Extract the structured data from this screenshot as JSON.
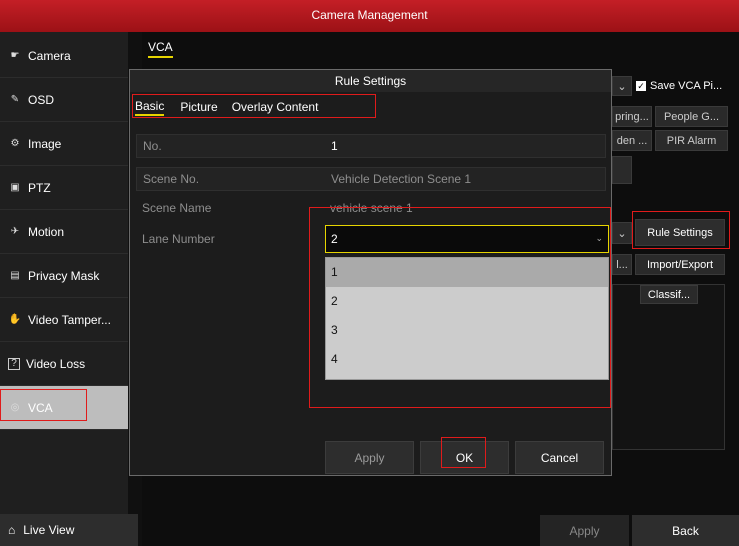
{
  "window": {
    "title": "Camera Management"
  },
  "sidebar": {
    "items": [
      {
        "label": "Camera",
        "icon": "camera-icon",
        "glyph": "☛"
      },
      {
        "label": "OSD",
        "icon": "osd-icon",
        "glyph": "✎"
      },
      {
        "label": "Image",
        "icon": "image-icon",
        "glyph": "⚙"
      },
      {
        "label": "PTZ",
        "icon": "ptz-icon",
        "glyph": "▣"
      },
      {
        "label": "Motion",
        "icon": "motion-icon",
        "glyph": "✈"
      },
      {
        "label": "Privacy Mask",
        "icon": "privacy-mask-icon",
        "glyph": "▤"
      },
      {
        "label": "Video Tamper...",
        "icon": "video-tamper-icon",
        "glyph": "✋"
      },
      {
        "label": "Video Loss",
        "icon": "video-loss-icon",
        "glyph": "?"
      },
      {
        "label": "VCA",
        "icon": "vca-icon",
        "glyph": "◎"
      }
    ],
    "active": "VCA",
    "live_view": "Live View"
  },
  "main": {
    "tab": "VCA",
    "save_vca": "Save VCA Pi...",
    "bg_buttons": [
      "pring...",
      "People G...",
      "den ...",
      "PIR Alarm"
    ],
    "rule_settings": "Rule Settings",
    "import_export": "Import/Export",
    "classify": "Classif...",
    "partial": "l...",
    "apply": "Apply",
    "back": "Back"
  },
  "dialog": {
    "title": "Rule Settings",
    "tabs": [
      "Basic",
      "Picture",
      "Overlay Content"
    ],
    "active_tab": "Basic",
    "fields": {
      "no_label": "No.",
      "no_value": "1",
      "scene_no_label": "Scene No.",
      "scene_no_value": "Vehicle Detection Scene 1",
      "scene_name_label": "Scene Name",
      "scene_name_value": "vehicle scene 1",
      "lane_label": "Lane Number",
      "lane_value": "2"
    },
    "lane_options": [
      "1",
      "2",
      "3",
      "4"
    ],
    "buttons": {
      "apply": "Apply",
      "ok": "OK",
      "cancel": "Cancel"
    }
  },
  "colors": {
    "title_red": "#b5181f",
    "accent_yellow": "#e6d400",
    "highlight_red": "#e01b1b"
  }
}
